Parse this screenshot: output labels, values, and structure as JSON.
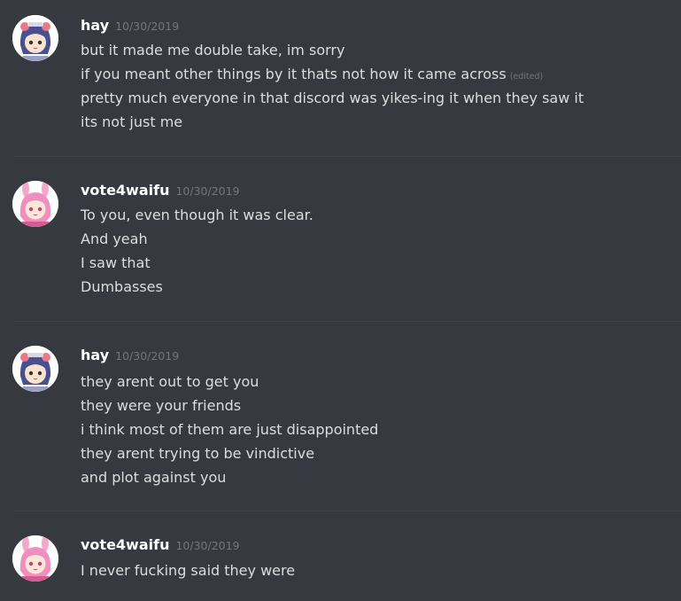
{
  "messages": [
    {
      "author": "hay",
      "timestamp": "10/30/2019",
      "avatar": "hay-avatar",
      "lines": [
        "but it made me double take, im sorry",
        "if you meant other things by it thats not how it came across",
        "pretty much everyone in that discord was yikes-ing it when they saw it",
        "its not just me"
      ],
      "edited_label": "(edited)"
    },
    {
      "author": "vote4waifu",
      "timestamp": "10/30/2019",
      "avatar": "vote4waifu-avatar",
      "lines": [
        "To you, even though it was clear.",
        "And yeah",
        "I saw that",
        "Dumbasses"
      ]
    },
    {
      "author": "hay",
      "timestamp": "10/30/2019",
      "avatar": "hay-avatar",
      "lines": [
        "they arent out to get you",
        "they were your friends",
        "i think most of them are just disappointed",
        "they arent trying to be vindictive",
        "and plot against you"
      ]
    },
    {
      "author": "vote4waifu",
      "timestamp": "10/30/2019",
      "avatar": "vote4waifu-avatar",
      "lines": [
        "I never fucking said they were"
      ]
    }
  ],
  "colors": {
    "background": "#36393f",
    "username": "#ffffff",
    "message_text": "#dcddde",
    "timestamp": "#72767d",
    "divider": "#42454a"
  }
}
